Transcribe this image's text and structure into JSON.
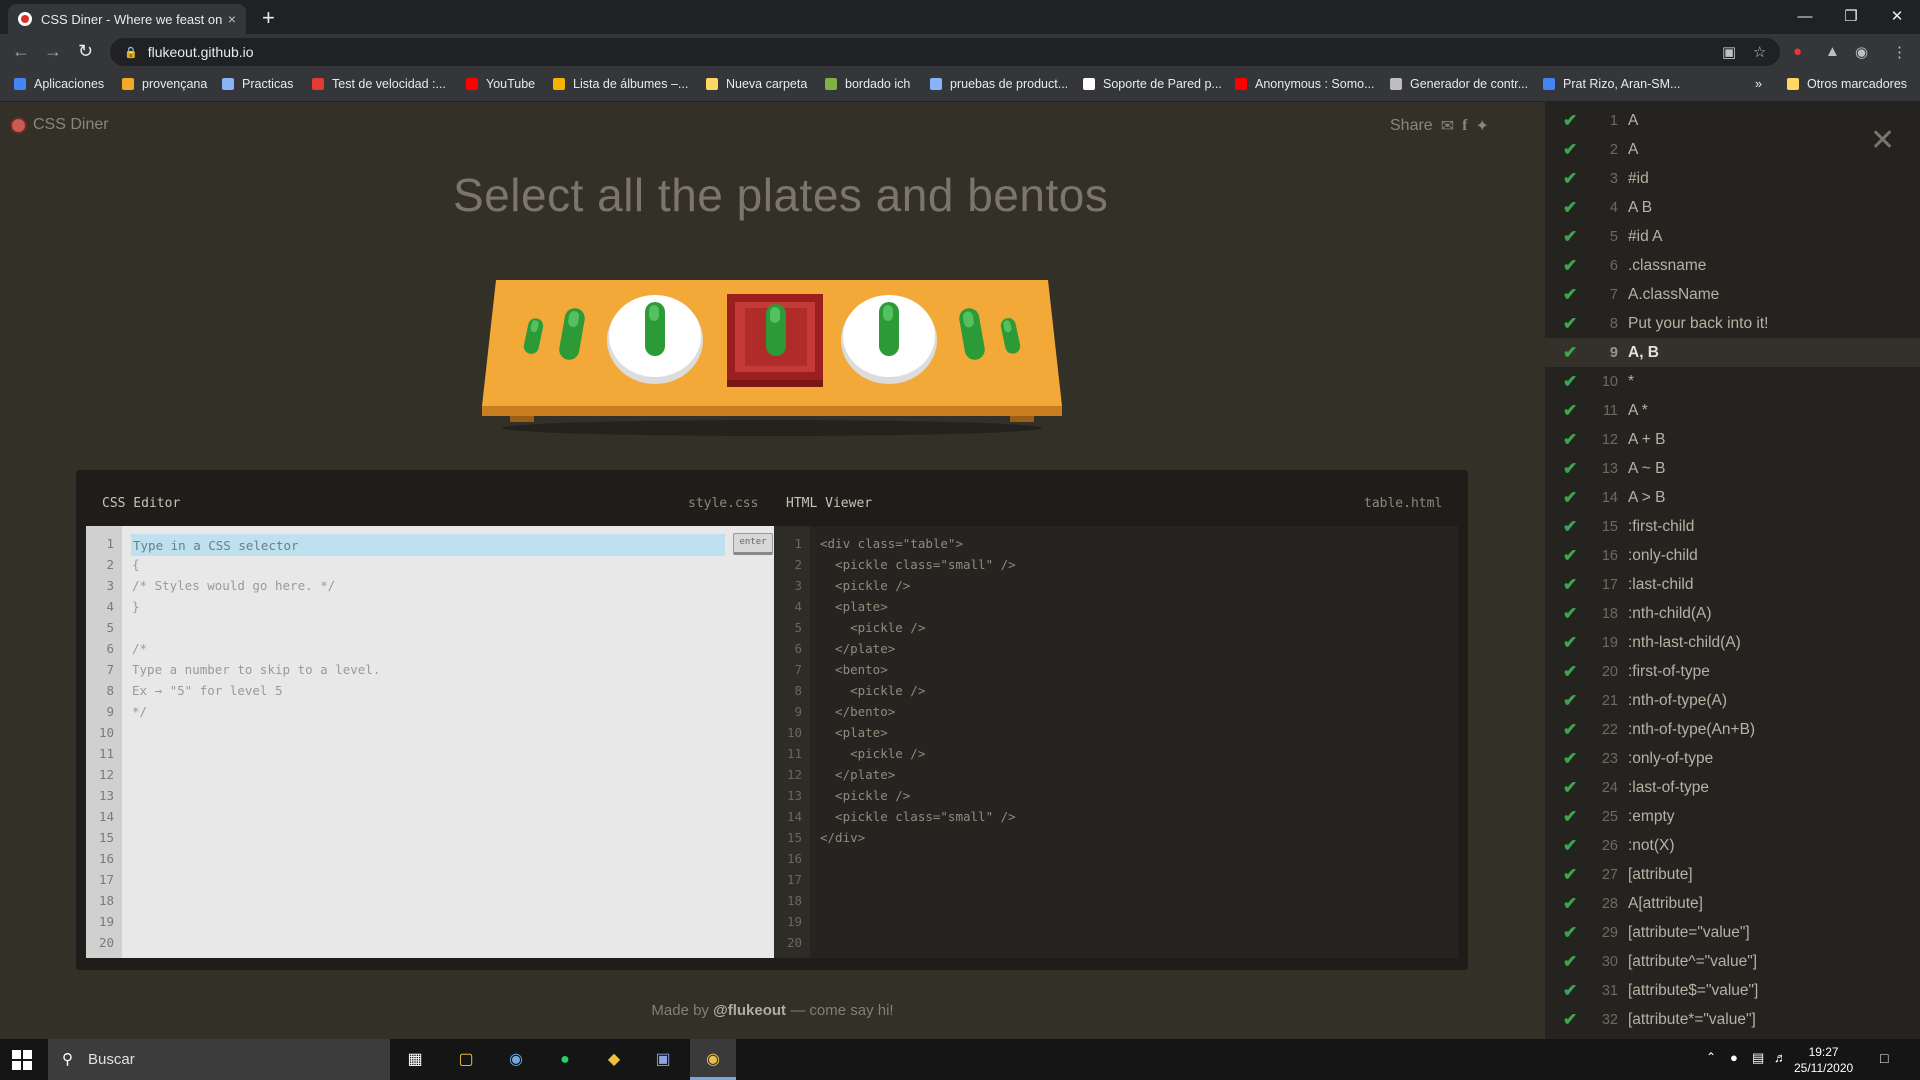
{
  "browser": {
    "tab_title": "CSS Diner - Where we feast on CSS Selectors!",
    "tab_close": "×",
    "new_tab": "+",
    "url": "flukeout.github.io",
    "bookmarks": [
      {
        "label": "Aplicaciones",
        "color": "#4285f4"
      },
      {
        "label": "provençana",
        "color": "#f9a825"
      },
      {
        "label": "Practicas",
        "color": "#8ab4f8"
      },
      {
        "label": "Test de velocidad :...",
        "color": "#e53935"
      },
      {
        "label": "YouTube",
        "color": "#ff0000"
      },
      {
        "label": "Lista de álbumes –...",
        "color": "#f4b400"
      },
      {
        "label": "Nueva carpeta",
        "color": "#fdd663"
      },
      {
        "label": "bordado ich",
        "color": "#7cb342"
      },
      {
        "label": "pruebas de product...",
        "color": "#8ab4f8"
      },
      {
        "label": "Soporte de Pared p...",
        "color": "#ffffff"
      },
      {
        "label": "Anonymous : Somo...",
        "color": "#ff0000"
      },
      {
        "label": "Generador de contr...",
        "color": "#bdbdbd"
      },
      {
        "label": "Prat Rizo, Aran-SM...",
        "color": "#4285f4"
      }
    ],
    "more_bookmarks": "»",
    "other_bookmarks": "Otros marcadores"
  },
  "app": {
    "logo": "CSS Diner",
    "share": "Share",
    "headline": "Select all the plates and bentos",
    "footer_prefix": "Made by ",
    "footer_author": "@flukeout",
    "footer_suffix": " — come say hi!"
  },
  "editor": {
    "css_title": "CSS Editor",
    "css_file": "style.css",
    "html_title": "HTML Viewer",
    "html_file": "table.html",
    "input_placeholder": "Type in a CSS selector",
    "enter_label": "enter",
    "css_lines": [
      "",
      "{",
      "/* Styles would go here. */",
      "}",
      "",
      "/*",
      "Type a number to skip to a level.",
      "Ex → \"5\" for level 5",
      "*/"
    ],
    "html_lines": [
      "<div class=\"table\">",
      "  <pickle class=\"small\" />",
      "  <pickle />",
      "  <plate>",
      "    <pickle />",
      "  </plate>",
      "  <bento>",
      "    <pickle />",
      "  </bento>",
      "  <plate>",
      "    <pickle />",
      "  </plate>",
      "  <pickle />",
      "  <pickle class=\"small\" />",
      "</div>"
    ],
    "line_numbers": [
      "1",
      "2",
      "3",
      "4",
      "5",
      "6",
      "7",
      "8",
      "9",
      "10",
      "11",
      "12",
      "13",
      "14",
      "15",
      "16",
      "17",
      "18",
      "19",
      "20"
    ]
  },
  "levels": {
    "current": 9,
    "items": [
      {
        "n": "1",
        "name": "A"
      },
      {
        "n": "2",
        "name": "A"
      },
      {
        "n": "3",
        "name": "#id"
      },
      {
        "n": "4",
        "name": "A B"
      },
      {
        "n": "5",
        "name": "#id A"
      },
      {
        "n": "6",
        "name": ".classname"
      },
      {
        "n": "7",
        "name": "A.className"
      },
      {
        "n": "8",
        "name": "Put your back into it!"
      },
      {
        "n": "9",
        "name": "A, B"
      },
      {
        "n": "10",
        "name": "*"
      },
      {
        "n": "11",
        "name": "A *"
      },
      {
        "n": "12",
        "name": "A + B"
      },
      {
        "n": "13",
        "name": "A ~ B"
      },
      {
        "n": "14",
        "name": "A > B"
      },
      {
        "n": "15",
        "name": ":first-child"
      },
      {
        "n": "16",
        "name": ":only-child"
      },
      {
        "n": "17",
        "name": ":last-child"
      },
      {
        "n": "18",
        "name": ":nth-child(A)"
      },
      {
        "n": "19",
        "name": ":nth-last-child(A)"
      },
      {
        "n": "20",
        "name": ":first-of-type"
      },
      {
        "n": "21",
        "name": ":nth-of-type(A)"
      },
      {
        "n": "22",
        "name": ":nth-of-type(An+B)"
      },
      {
        "n": "23",
        "name": ":only-of-type"
      },
      {
        "n": "24",
        "name": ":last-of-type"
      },
      {
        "n": "25",
        "name": ":empty"
      },
      {
        "n": "26",
        "name": ":not(X)"
      },
      {
        "n": "27",
        "name": "[attribute]"
      },
      {
        "n": "28",
        "name": "A[attribute]"
      },
      {
        "n": "29",
        "name": "[attribute=\"value\"]"
      },
      {
        "n": "30",
        "name": "[attribute^=\"value\"]"
      },
      {
        "n": "31",
        "name": "[attribute$=\"value\"]"
      },
      {
        "n": "32",
        "name": "[attribute*=\"value\"]"
      }
    ]
  },
  "taskbar": {
    "search": "Buscar",
    "time": "19:27",
    "date": "25/11/2020"
  }
}
